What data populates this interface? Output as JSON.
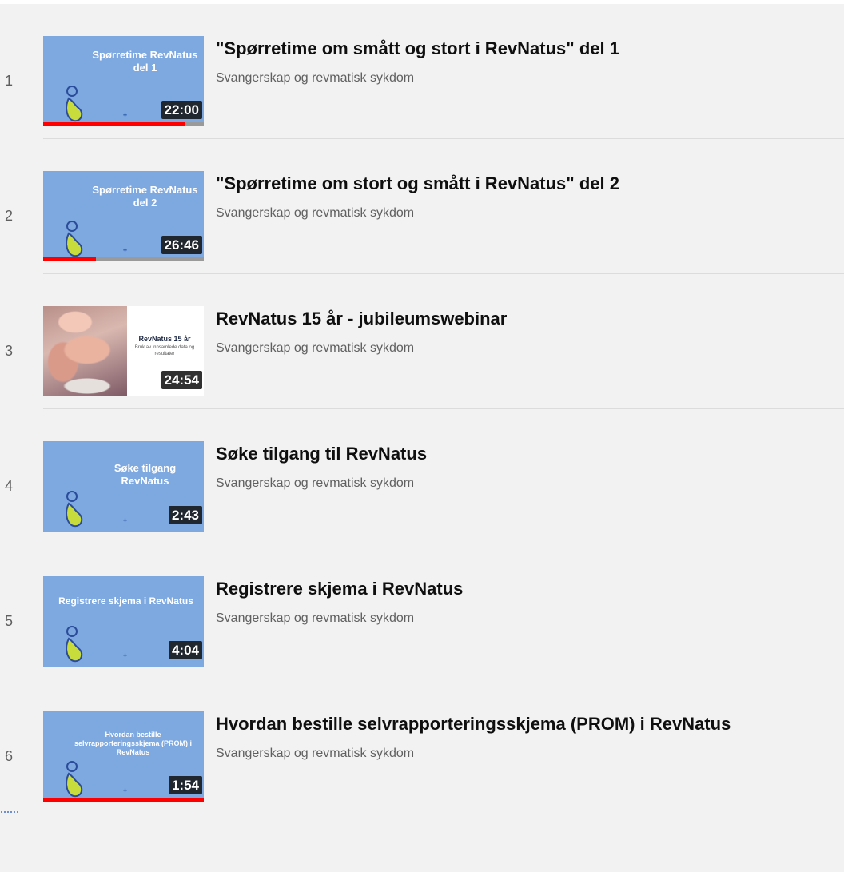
{
  "playlist": {
    "items": [
      {
        "index": "1",
        "thumb_text": "Spørretime RevNatus del 1",
        "duration": "22:00",
        "progress": 0.88,
        "title": "\"Spørretime om smått og stort i RevNatus\" del 1",
        "channel": "Svangerskap og revmatisk sykdom"
      },
      {
        "index": "2",
        "thumb_text": "Spørretime RevNatus del 2",
        "duration": "26:46",
        "progress": 0.33,
        "title": "\"Spørretime om stort og smått i RevNatus\" del 2",
        "channel": "Svangerskap og revmatisk sykdom"
      },
      {
        "index": "3",
        "thumb_text": "RevNatus 15 år",
        "thumb_subtext": "Bruk av innsamlede data og resultater",
        "duration": "24:54",
        "title": "RevNatus 15 år - jubileumswebinar",
        "channel": "Svangerskap og revmatisk sykdom"
      },
      {
        "index": "4",
        "thumb_text": "Søke tilgang RevNatus",
        "duration": "2:43",
        "title": "Søke tilgang til RevNatus",
        "channel": "Svangerskap og revmatisk sykdom"
      },
      {
        "index": "5",
        "thumb_text": "Registrere skjema i RevNatus",
        "duration": "4:04",
        "title": "Registrere skjema i RevNatus",
        "channel": "Svangerskap og revmatisk sykdom"
      },
      {
        "index": "6",
        "thumb_text": "Hvordan bestille selvrapporteringsskjema (PROM) i RevNatus",
        "duration": "1:54",
        "progress": 1.0,
        "title": "Hvordan bestille selvrapporteringsskjema (PROM) i RevNatus",
        "channel": "Svangerskap og revmatisk sykdom"
      }
    ]
  },
  "colors": {
    "thumb_bg": "#7ea8e0",
    "progress": "#ff0000",
    "panel_bg": "#f2f2f2"
  }
}
